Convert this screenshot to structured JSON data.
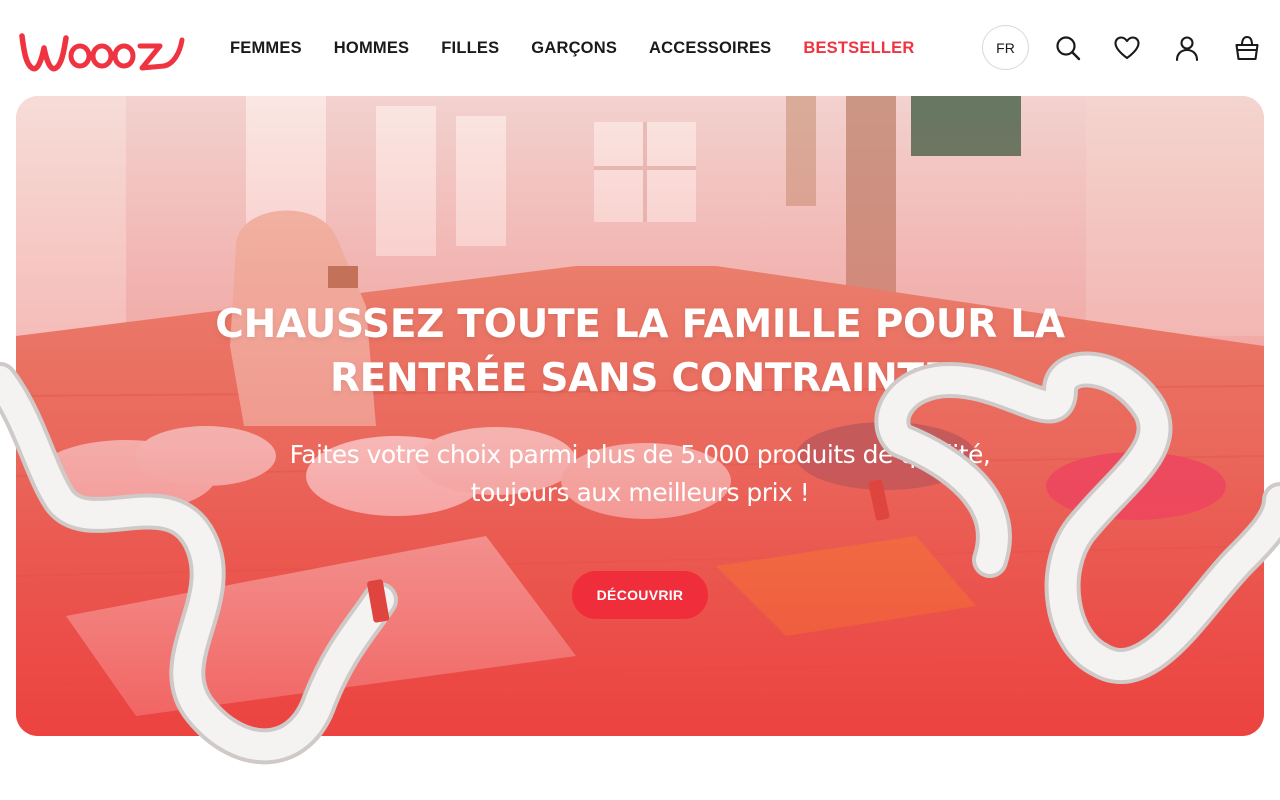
{
  "header": {
    "logo_text": "Woooz",
    "nav": [
      {
        "label": "FEMMES"
      },
      {
        "label": "HOMMES"
      },
      {
        "label": "FILLES"
      },
      {
        "label": "GARÇONS"
      },
      {
        "label": "ACCESSOIRES"
      },
      {
        "label": "BESTSELLER"
      }
    ],
    "language": "FR",
    "icons": [
      "search-icon",
      "heart-icon",
      "user-icon",
      "bag-icon"
    ]
  },
  "hero": {
    "title_line1": "CHAUSSEZ TOUTE LA FAMILLE POUR LA",
    "title_line2": "RENTRÉE SANS CONTRAINTE",
    "subtitle_line1": "Faites votre choix parmi plus de 5.000 produits de qualité,",
    "subtitle_line2": "toujours aux meilleurs prix !",
    "cta_label": "DÉCOUVRIR"
  },
  "colors": {
    "brand": "#ef3340",
    "text": "#1a1a1a",
    "hero_overlay": "#ef4a4a"
  }
}
